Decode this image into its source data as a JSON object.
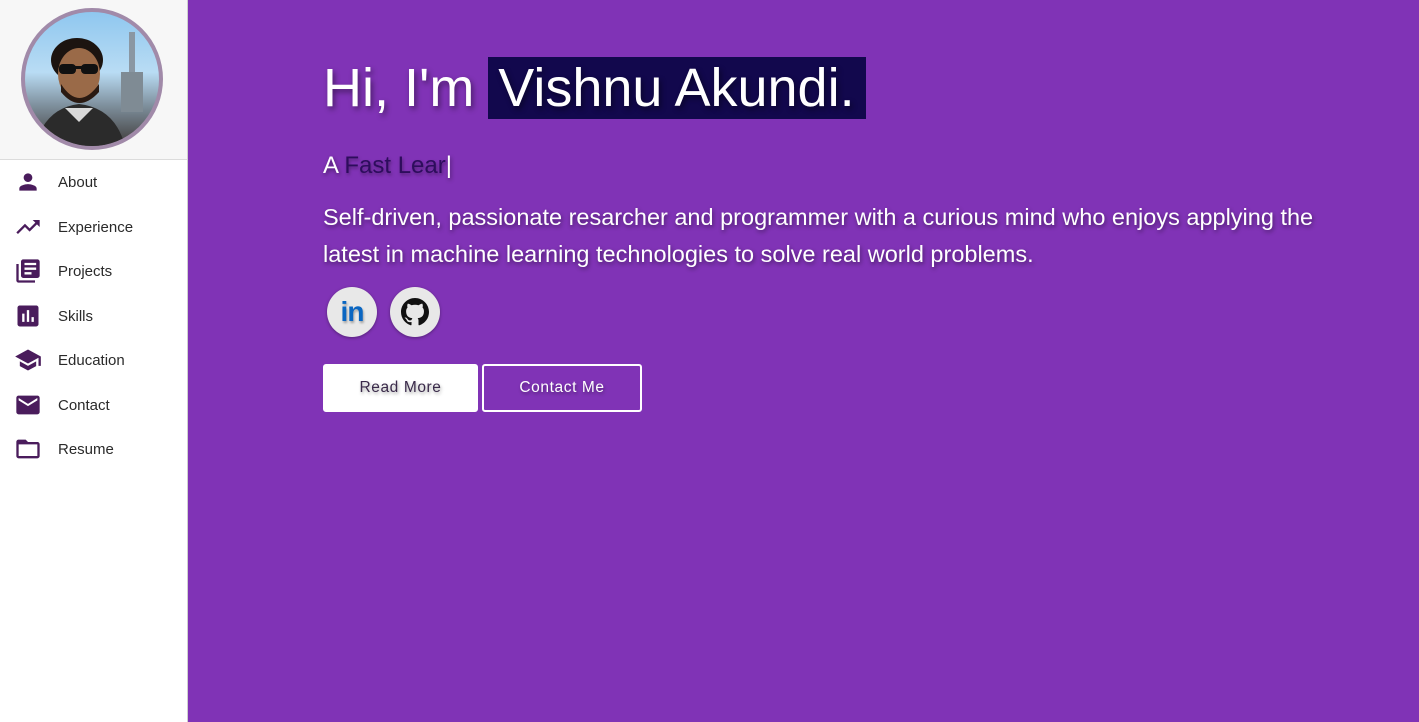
{
  "sidebar": {
    "items": [
      {
        "label": "About",
        "icon": "person-icon"
      },
      {
        "label": "Experience",
        "icon": "trending-up-icon"
      },
      {
        "label": "Projects",
        "icon": "library-books-icon"
      },
      {
        "label": "Skills",
        "icon": "bar-chart-icon"
      },
      {
        "label": "Education",
        "icon": "school-icon"
      },
      {
        "label": "Contact",
        "icon": "mail-icon"
      },
      {
        "label": "Resume",
        "icon": "folder-icon"
      }
    ]
  },
  "hero": {
    "greeting": "Hi, I'm",
    "name": "Vishnu Akundi.",
    "typed_prefix": "A",
    "typed_role": "Fast Lear",
    "typed_cursor": "|",
    "bio": "Self-driven, passionate resarcher and programmer with a curious mind who enjoys applying the latest in machine learning technologies to solve real world problems.",
    "linkedin_text": "in",
    "read_more_label": "Read More",
    "contact_label": "Contact Me"
  },
  "colors": {
    "background": "#8033b6",
    "name_highlight": "#12084d",
    "icon": "#4a1c5c",
    "linkedin": "#0a66c2"
  }
}
